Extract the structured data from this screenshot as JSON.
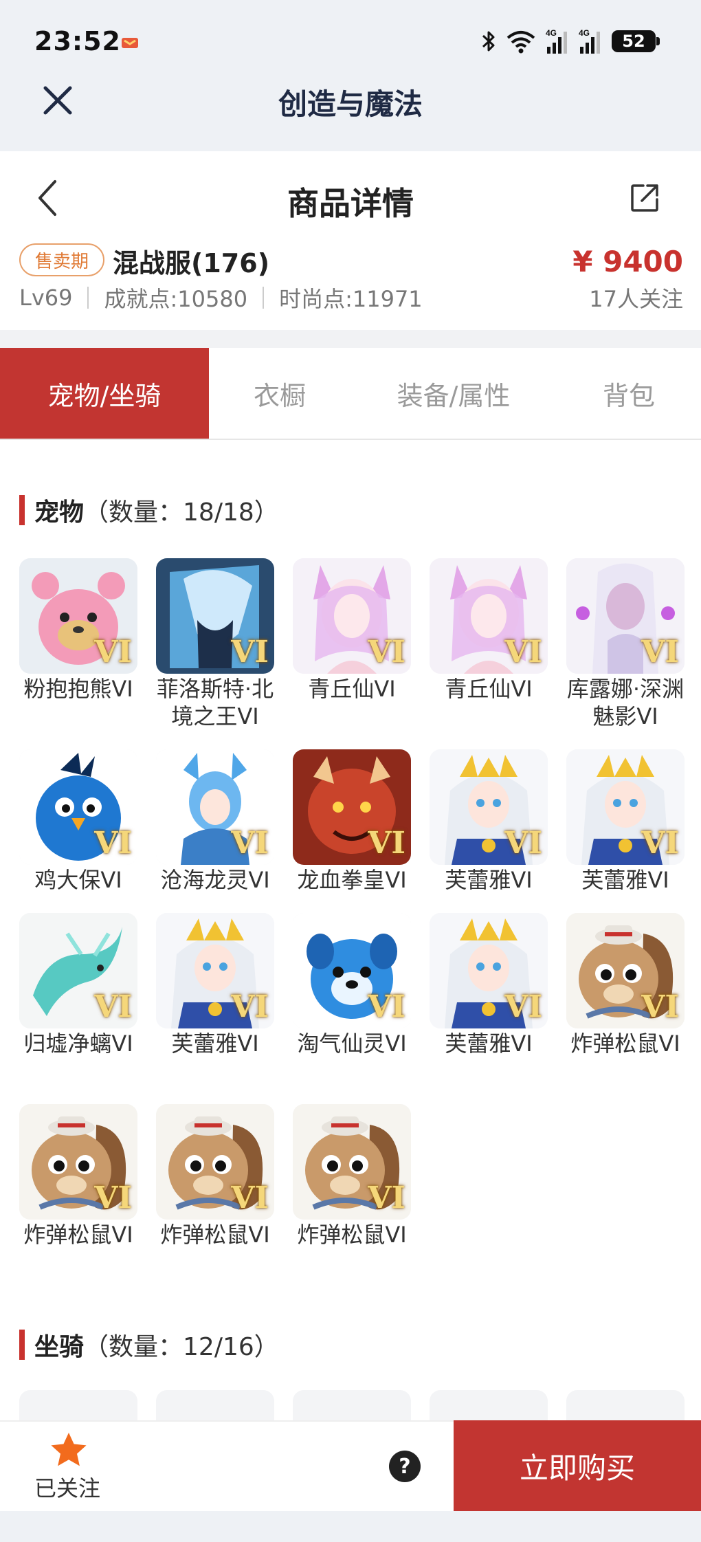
{
  "status_bar": {
    "time": "23:52",
    "signal_labels": [
      "4G",
      "4G"
    ],
    "battery": "52",
    "icons": [
      "game-notification-icon",
      "bluetooth-icon",
      "wifi-icon",
      "signal-icon",
      "signal-icon",
      "battery-icon"
    ]
  },
  "app_bar": {
    "title": "创造与魔法",
    "close_icon": "close-icon"
  },
  "header": {
    "title": "商品详情",
    "back_icon": "chevron-left-icon",
    "share_icon": "share-icon"
  },
  "product": {
    "badge": "售卖期",
    "server": "混战服(176)",
    "price": "¥ 9400",
    "level": "Lv69",
    "achievement": "成就点:10580",
    "fashion": "时尚点:11971",
    "followers": "17人关注"
  },
  "tabs": [
    {
      "label": "宠物/坐骑",
      "active": true
    },
    {
      "label": "衣橱",
      "active": false
    },
    {
      "label": "装备/属性",
      "active": false
    },
    {
      "label": "背包",
      "active": false
    }
  ],
  "pets_section": {
    "title": "宠物",
    "count": "（数量：18/18）"
  },
  "pets": [
    {
      "name": "粉抱抱熊VI",
      "badge": "VI",
      "icon": "pink-bear"
    },
    {
      "name": "菲洛斯特·北境之王VI",
      "badge": "VI",
      "icon": "ice-king"
    },
    {
      "name": "青丘仙VI",
      "badge": "VI",
      "icon": "fox-fairy"
    },
    {
      "name": "青丘仙VI",
      "badge": "VI",
      "icon": "fox-fairy"
    },
    {
      "name": "库露娜·深渊魅影VI",
      "badge": "VI",
      "icon": "abyss-phantom"
    },
    {
      "name": "鸡大保VI",
      "badge": "VI",
      "icon": "blue-chicken"
    },
    {
      "name": "沧海龙灵VI",
      "badge": "VI",
      "icon": "dragon-spirit"
    },
    {
      "name": "龙血拳皇VI",
      "badge": "VI",
      "icon": "red-beast"
    },
    {
      "name": "芙蕾雅VI",
      "badge": "VI",
      "icon": "freya"
    },
    {
      "name": "芙蕾雅VI",
      "badge": "VI",
      "icon": "freya"
    },
    {
      "name": "归墟净螭VI",
      "badge": "VI",
      "icon": "jade-dragon"
    },
    {
      "name": "芙蕾雅VI",
      "badge": "VI",
      "icon": "freya"
    },
    {
      "name": "淘气仙灵VI",
      "badge": "VI",
      "icon": "blue-pup"
    },
    {
      "name": "芙蕾雅VI",
      "badge": "VI",
      "icon": "freya"
    },
    {
      "name": "炸弹松鼠VI",
      "badge": "VI",
      "icon": "bomb-squirrel"
    },
    {
      "name": "炸弹松鼠VI",
      "badge": "VI",
      "icon": "bomb-squirrel"
    },
    {
      "name": "炸弹松鼠VI",
      "badge": "VI",
      "icon": "bomb-squirrel"
    },
    {
      "name": "炸弹松鼠VI",
      "badge": "VI",
      "icon": "bomb-squirrel"
    }
  ],
  "mounts_section": {
    "title": "坐骑",
    "count": "（数量：12/16）"
  },
  "bottom_bar": {
    "followed_label": "已关注",
    "help_label": "?",
    "buy_label": "立即购买",
    "star_icon": "star-icon"
  },
  "colors": {
    "accent": "#c23531",
    "price": "#c8322e",
    "badge": "#e07a35",
    "app_title": "#1f2a44"
  }
}
